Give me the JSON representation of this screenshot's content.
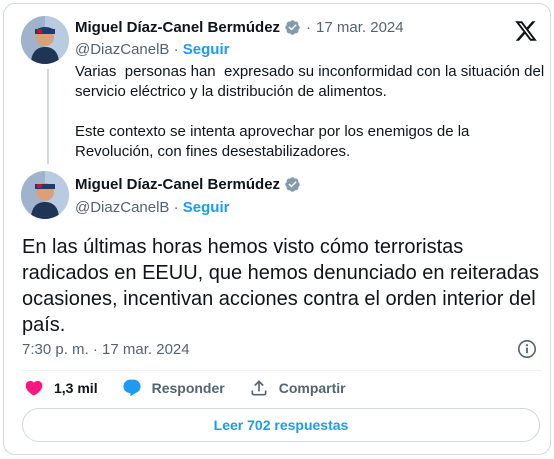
{
  "quoted": {
    "author_name": "Miguel Díaz-Canel Bermúdez",
    "date": "17 mar. 2024",
    "handle": "@DiazCanelB",
    "follow_label": "Seguir",
    "paragraphs": [
      "Varias  personas han  expresado su inconformidad con la situación del servicio eléctrico y la distribución de alimentos.",
      "Este contexto se intenta aprovechar por los enemigos de la Revolución, con fines desestabilizadores."
    ]
  },
  "main": {
    "author_name": "Miguel Díaz-Canel Bermúdez",
    "handle": "@DiazCanelB",
    "follow_label": "Seguir",
    "text": "En las últimas horas hemos visto cómo terroristas radicados en EEUU, que hemos denunciado en reiteradas ocasiones, incentivan acciones contra el orden interior del país.",
    "timestamp": "7:30 p. m. · 17 mar. 2024"
  },
  "actions": {
    "likes": "1,3 mil",
    "reply_label": "Responder",
    "share_label": "Compartir"
  },
  "read_replies_label": "Leer 702 respuestas",
  "colors": {
    "accent": "#1d9bf0",
    "like": "#f91880",
    "verified": "#829aab",
    "secondary_text": "#536471"
  }
}
